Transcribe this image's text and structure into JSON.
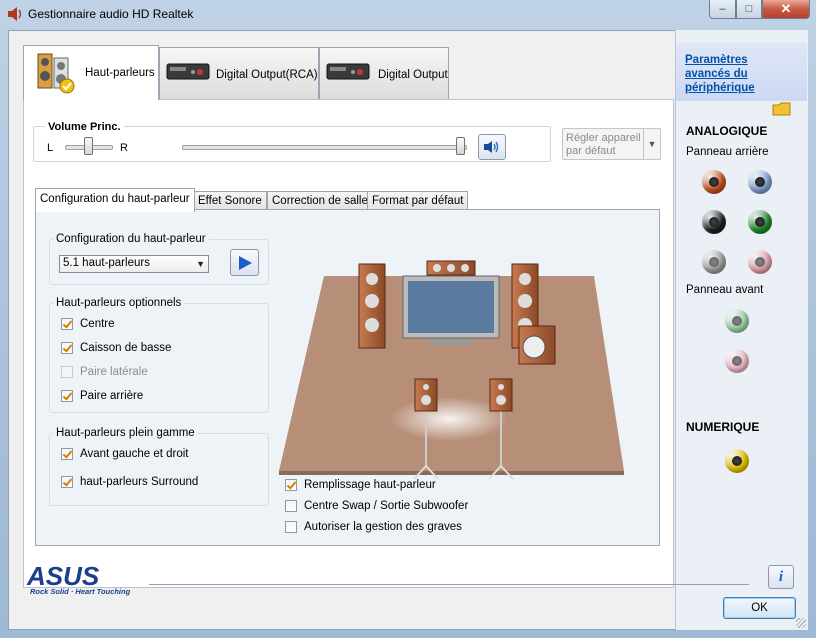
{
  "window": {
    "title": "Gestionnaire audio HD Realtek",
    "min_label": "–",
    "max_label": "□",
    "close_label": "✕"
  },
  "device_tabs": [
    {
      "label": "Haut-parleurs",
      "active": true
    },
    {
      "label": "Digital Output(RCA)",
      "active": false
    },
    {
      "label": "Digital Output",
      "active": false
    }
  ],
  "volume": {
    "title": "Volume Princ.",
    "left_label": "L",
    "right_label": "R",
    "balance": 0.5,
    "level": 1.0,
    "default_button": "Régler appareil par défaut"
  },
  "sub_tabs": [
    {
      "label": "Configuration du haut-parleur",
      "active": true
    },
    {
      "label": "Effet Sonore",
      "active": false
    },
    {
      "label": "Correction de salle",
      "active": false
    },
    {
      "label": "Format par défaut",
      "active": false
    }
  ],
  "config": {
    "group_title": "Configuration du haut-parleur",
    "selected": "5.1 haut-parleurs"
  },
  "optional": {
    "group_title": "Haut-parleurs optionnels",
    "items": [
      {
        "label": "Centre",
        "checked": true,
        "disabled": false
      },
      {
        "label": "Caisson de basse",
        "checked": true,
        "disabled": false
      },
      {
        "label": "Paire latérale",
        "checked": false,
        "disabled": true
      },
      {
        "label": "Paire arrière",
        "checked": true,
        "disabled": false
      }
    ]
  },
  "fullrange": {
    "group_title": "Haut-parleurs plein gamme",
    "items": [
      {
        "label": "Avant gauche et droit",
        "checked": true
      },
      {
        "label": "haut-parleurs Surround",
        "checked": true
      }
    ]
  },
  "bottom_options": [
    {
      "label": "Remplissage haut-parleur",
      "checked": true
    },
    {
      "label": "Centre Swap / Sortie Subwoofer",
      "checked": false
    },
    {
      "label": "Autoriser la gestion des graves",
      "checked": false
    }
  ],
  "side": {
    "advanced_link": "Paramètres avancés du périphérique",
    "analog_title": "ANALOGIQUE",
    "rear_panel": "Panneau arrière",
    "front_panel": "Panneau avant",
    "digital_title": "NUMERIQUE",
    "jack_colors": {
      "orange": "#c8501e",
      "blue": "#7f9fd0",
      "black": "#202020",
      "green": "#1e8a2e",
      "grey": "#9c9c9c",
      "pink": "#e0a0a8",
      "front_green": "#9fd0a8",
      "front_pink": "#f0b8c4",
      "spdif": "#e8c000"
    }
  },
  "footer": {
    "brand": "ASUS",
    "tagline": "Rock Solid · Heart Touching",
    "ok_label": "OK",
    "info_label": "i"
  },
  "colors": {
    "accent_check": "#e07a00",
    "link": "#0052a8",
    "asus_blue": "#1d3d8f"
  }
}
